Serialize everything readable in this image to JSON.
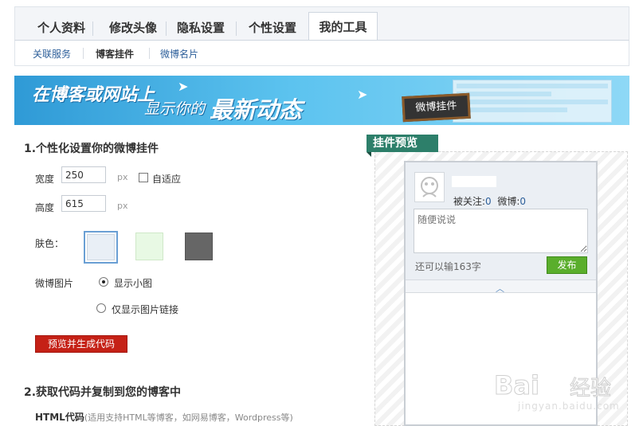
{
  "tabs": [
    "个人资料",
    "修改头像",
    "隐私设置",
    "个性设置",
    "我的工具"
  ],
  "active_tab": "我的工具",
  "subnav": [
    "关联服务",
    "博客挂件",
    "微博名片"
  ],
  "active_subnav": "博客挂件",
  "banner": {
    "line1": "在博客或网站上",
    "line2": "显示你的",
    "line3": "最新动态",
    "sign": "微博挂件"
  },
  "section1": {
    "title": "1.个性化设置你的微博挂件",
    "width_label": "宽度",
    "width_value": "250",
    "width_unit": "px",
    "auto_label": "自适应",
    "height_label": "高度",
    "height_value": "615",
    "height_unit": "px",
    "skin_label": "肤色：",
    "skins": [
      "#e9eff6",
      "#e8f9e4",
      "#666666"
    ],
    "pic_label": "微博图片",
    "pic_option1": "显示小图",
    "pic_option2": "仅显示图片链接",
    "generate_button": "预览并生成代码"
  },
  "section2": {
    "title": "2.获取代码并复制到您的博客中",
    "html_label": "HTML代码",
    "html_note": "(适用支持HTML等博客，如网易博客，Wordpress等)"
  },
  "preview": {
    "tag": "挂件预览",
    "followers_label": "被关注:",
    "followers": "0",
    "weibo_label": "微博:",
    "weibo_count": "0",
    "placeholder": "随便说说",
    "counter": "还可以输163字",
    "publish_button": "发布"
  },
  "watermark": {
    "brand": "Bai",
    "cn": "经验",
    "url": "jingyan.baidu.com"
  }
}
